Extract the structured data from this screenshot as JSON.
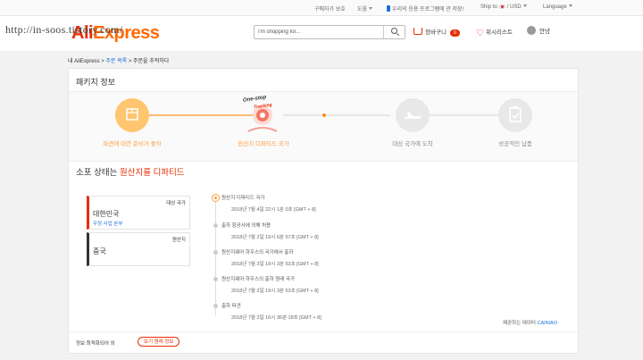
{
  "topbar": {
    "buyer_protection": "구매자가 보호",
    "help": "도움",
    "app_promo": "우리의 응용 프로그램에 관 저장!",
    "ship_to": "Ship to",
    "currency": "USD",
    "language": "Language"
  },
  "header": {
    "logo_ali": "Ali",
    "logo_express": "Express",
    "search_placeholder": "I'm shopping for...",
    "cart_label": "장바구니",
    "cart_count": "0",
    "wishlist_label": "위시리스트",
    "user_label": "안녕"
  },
  "watermark": "http://in-soos.tistory.com/",
  "breadcrumb": {
    "home": "내 AliExpress",
    "orders": "주문 목록",
    "current": "주문을 추적하다",
    "sep": ">"
  },
  "card": {
    "title": "패키지 정보",
    "steps": [
      {
        "label": "파견에 대한 준비가 좋아",
        "state": "done"
      },
      {
        "label": "원산지 디파티드 국가",
        "state": "current",
        "badge_line1": "One-stop",
        "badge_line2": "Tracking"
      },
      {
        "label": "대상 국가에 도착",
        "state": "pending"
      },
      {
        "label": "성공적인 납품",
        "state": "pending"
      }
    ],
    "status_prefix": "소포 상태는",
    "status_value": "원산지를 디파티드",
    "destination": {
      "label": "대상 국가",
      "country": "대한민국",
      "service": "우정 사업 본부"
    },
    "origin": {
      "label": "원산지",
      "country": "중국"
    },
    "events": [
      {
        "title": "원산지 디파티드 국가",
        "datetime": "2018년 7월 4일 22시 1분 0초 [GMT + 8]",
        "active": true
      },
      {
        "title": "출하 항공사에 의해 허용",
        "datetime": "2018년 7월 2일 19시 6분 57초 [GMT + 8]",
        "active": false
      },
      {
        "title": "원산지웨어 하우스의 국가에서 출하",
        "datetime": "2018년 7월 2일 19시 3분 53초 [GMT + 8]",
        "active": false
      },
      {
        "title": "원산지웨어 하우스의 출하 원래 국가",
        "datetime": "2018년 7월 2일 19시 3분 53초 [GMT + 8]",
        "active": false
      },
      {
        "title": "출하 파견",
        "datetime": "2018년 7월 2일 16시 36분 18초 [GMT + 8]",
        "active": false
      }
    ],
    "provider_prefix": "제공하는 데이터",
    "provider_name": "CAINIAO",
    "optimize_label": "정보 최적화되어 외",
    "original_btn": "보기 원래 정보"
  },
  "colors": {
    "accent": "#e62e04",
    "orange": "#ff9c3f",
    "link": "#1e6fd9",
    "pending_grey": "#e8e8e8"
  }
}
